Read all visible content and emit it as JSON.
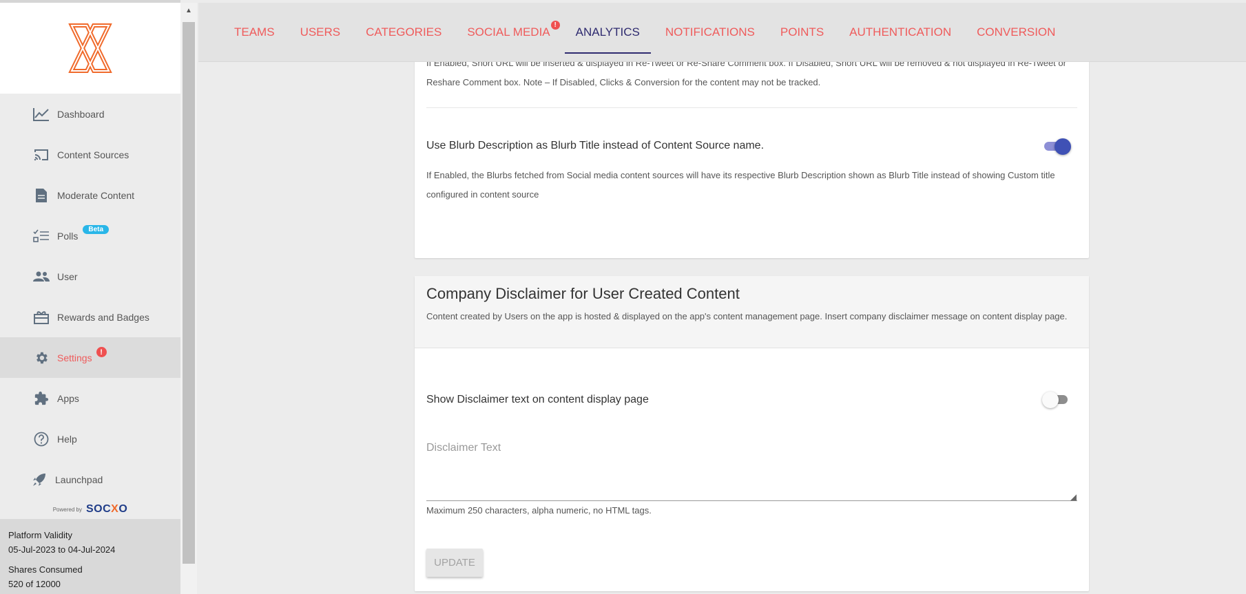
{
  "sidebar": {
    "items": [
      {
        "label": "Dashboard",
        "icon": "chart-line-icon"
      },
      {
        "label": "Content Sources",
        "icon": "cast-icon"
      },
      {
        "label": "Moderate Content",
        "icon": "document-icon"
      },
      {
        "label": "Polls",
        "icon": "checklist-icon",
        "badge": "Beta"
      },
      {
        "label": "User",
        "icon": "people-icon"
      },
      {
        "label": "Rewards and Badges",
        "icon": "gift-icon"
      },
      {
        "label": "Settings",
        "icon": "gear-icon",
        "alert": "!"
      },
      {
        "label": "Apps",
        "icon": "puzzle-icon"
      },
      {
        "label": "Help",
        "icon": "help-circle-icon"
      },
      {
        "label": "Launchpad",
        "icon": "rocket-icon"
      }
    ],
    "powered_by": "Powered by",
    "brand_a": "SOC",
    "brand_b": "X",
    "brand_c": "O",
    "validity_label": "Platform Validity",
    "validity_value": "05-Jul-2023 to 04-Jul-2024",
    "shares_label": "Shares Consumed",
    "shares_value": "520 of 12000"
  },
  "tabs": [
    {
      "label": "TEAMS"
    },
    {
      "label": "USERS"
    },
    {
      "label": "CATEGORIES"
    },
    {
      "label": "SOCIAL MEDIA",
      "alert": "!"
    },
    {
      "label": "ANALYTICS",
      "active": true
    },
    {
      "label": "NOTIFICATIONS"
    },
    {
      "label": "POINTS"
    },
    {
      "label": "AUTHENTICATION"
    },
    {
      "label": "CONVERSION"
    }
  ],
  "card1": {
    "partial_text": "If Enabled, Short URL will be inserted & displayed in Re-Tweet or Re-Share Comment box. If Disabled, Short URL will be removed & not displayed in Re-Tweet or Reshare Comment box. Note – If Disabled, Clicks & Conversion for the content may not be tracked.",
    "setting_title": "Use Blurb Description as Blurb Title instead of Content Source name.",
    "setting_desc": "If Enabled, the Blurbs fetched from Social media content sources will have its respective Blurb Description shown as Blurb Title instead of showing Custom title configured in content source",
    "toggle_on": true
  },
  "card2": {
    "title": "Company Disclaimer for User Created Content",
    "subtitle": "Content created by Users on the app is hosted & displayed on the app's content management page. Insert company disclaimer message on content display page.",
    "toggle_label": "Show Disclaimer text on content display page",
    "toggle_on": false,
    "disclaimer_label": "Disclaimer Text",
    "disclaimer_value": "",
    "hint": "Maximum 250 characters, alpha numeric, no HTML tags.",
    "update_label": "UPDATE"
  },
  "colors": {
    "accent": "#ef5b5b",
    "active_tab": "#2e2a6f",
    "toggle_on": "#3f51b5",
    "beta_badge": "#29b6e8"
  }
}
